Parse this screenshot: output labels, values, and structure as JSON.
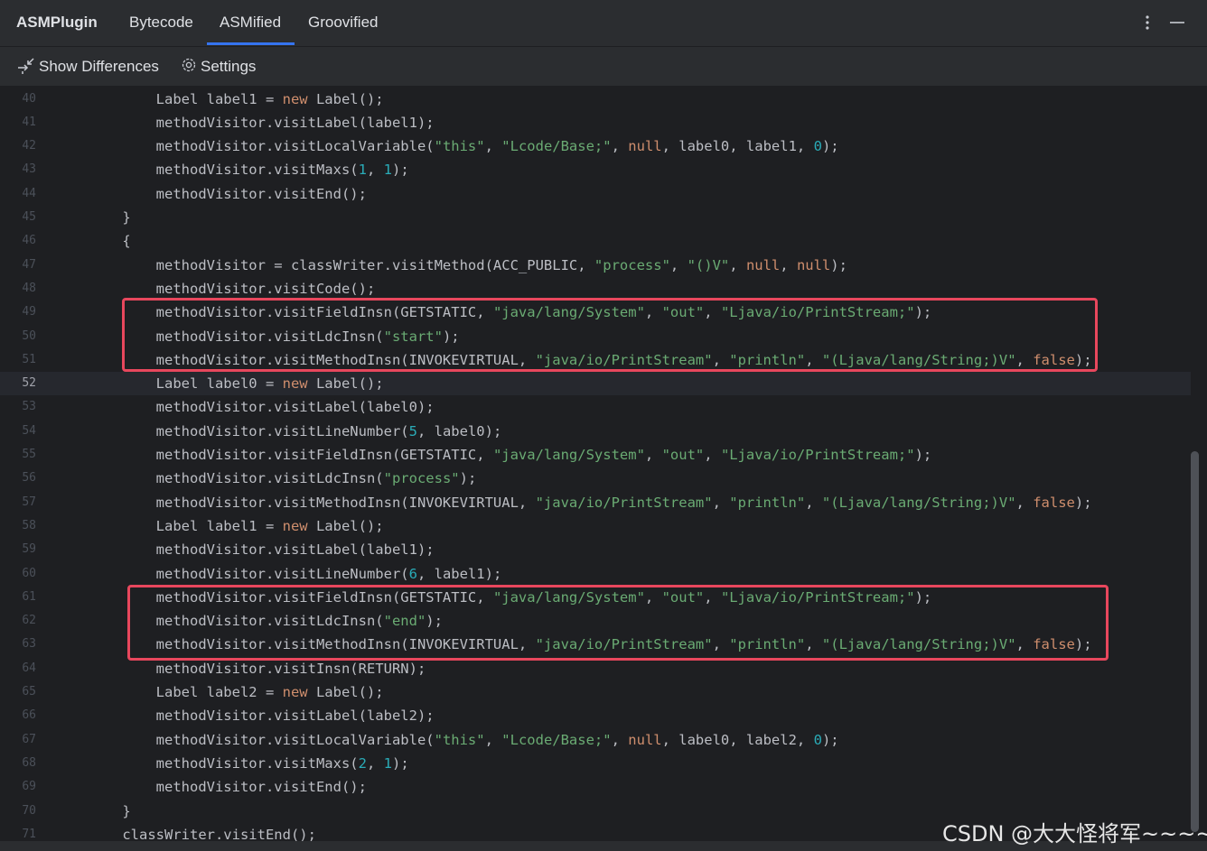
{
  "header": {
    "app_name": "ASMPlugin",
    "tabs": [
      {
        "label": "Bytecode",
        "active": false
      },
      {
        "label": "ASMified",
        "active": true
      },
      {
        "label": "Groovified",
        "active": false
      }
    ]
  },
  "toolbar": {
    "show_differences_label": "Show Differences",
    "settings_label": "Settings"
  },
  "editor": {
    "current_line": 52,
    "lines": [
      {
        "n": "40",
        "code": "        Label label1 = new Label();"
      },
      {
        "n": "41",
        "code": "        methodVisitor.visitLabel(label1);"
      },
      {
        "n": "42",
        "code": "        methodVisitor.visitLocalVariable(\"this\", \"Lcode/Base;\", null, label0, label1, 0);"
      },
      {
        "n": "43",
        "code": "        methodVisitor.visitMaxs(1, 1);"
      },
      {
        "n": "44",
        "code": "        methodVisitor.visitEnd();"
      },
      {
        "n": "45",
        "code": "    }"
      },
      {
        "n": "46",
        "code": "    {"
      },
      {
        "n": "47",
        "code": "        methodVisitor = classWriter.visitMethod(ACC_PUBLIC, \"process\", \"()V\", null, null);"
      },
      {
        "n": "48",
        "code": "        methodVisitor.visitCode();"
      },
      {
        "n": "49",
        "code": "        methodVisitor.visitFieldInsn(GETSTATIC, \"java/lang/System\", \"out\", \"Ljava/io/PrintStream;\");"
      },
      {
        "n": "50",
        "code": "        methodVisitor.visitLdcInsn(\"start\");"
      },
      {
        "n": "51",
        "code": "        methodVisitor.visitMethodInsn(INVOKEVIRTUAL, \"java/io/PrintStream\", \"println\", \"(Ljava/lang/String;)V\", false);"
      },
      {
        "n": "52",
        "code": "        Label label0 = new Label();"
      },
      {
        "n": "53",
        "code": "        methodVisitor.visitLabel(label0);"
      },
      {
        "n": "54",
        "code": "        methodVisitor.visitLineNumber(5, label0);"
      },
      {
        "n": "55",
        "code": "        methodVisitor.visitFieldInsn(GETSTATIC, \"java/lang/System\", \"out\", \"Ljava/io/PrintStream;\");"
      },
      {
        "n": "56",
        "code": "        methodVisitor.visitLdcInsn(\"process\");"
      },
      {
        "n": "57",
        "code": "        methodVisitor.visitMethodInsn(INVOKEVIRTUAL, \"java/io/PrintStream\", \"println\", \"(Ljava/lang/String;)V\", false);"
      },
      {
        "n": "58",
        "code": "        Label label1 = new Label();"
      },
      {
        "n": "59",
        "code": "        methodVisitor.visitLabel(label1);"
      },
      {
        "n": "60",
        "code": "        methodVisitor.visitLineNumber(6, label1);"
      },
      {
        "n": "61",
        "code": "        methodVisitor.visitFieldInsn(GETSTATIC, \"java/lang/System\", \"out\", \"Ljava/io/PrintStream;\");"
      },
      {
        "n": "62",
        "code": "        methodVisitor.visitLdcInsn(\"end\");"
      },
      {
        "n": "63",
        "code": "        methodVisitor.visitMethodInsn(INVOKEVIRTUAL, \"java/io/PrintStream\", \"println\", \"(Ljava/lang/String;)V\", false);"
      },
      {
        "n": "64",
        "code": "        methodVisitor.visitInsn(RETURN);"
      },
      {
        "n": "65",
        "code": "        Label label2 = new Label();"
      },
      {
        "n": "66",
        "code": "        methodVisitor.visitLabel(label2);"
      },
      {
        "n": "67",
        "code": "        methodVisitor.visitLocalVariable(\"this\", \"Lcode/Base;\", null, label0, label2, 0);"
      },
      {
        "n": "68",
        "code": "        methodVisitor.visitMaxs(2, 1);"
      },
      {
        "n": "69",
        "code": "        methodVisitor.visitEnd();"
      },
      {
        "n": "70",
        "code": "    }"
      },
      {
        "n": "71",
        "code": "    classWriter.visitEnd();"
      }
    ]
  },
  "colors": {
    "keyword": "#cf8e6d",
    "string": "#6aab73",
    "number": "#2aacb8",
    "highlight_box": "#e8475d",
    "active_tab_underline": "#3574f0"
  },
  "icons": [
    "show-differences-icon",
    "settings-gear-icon",
    "more-options-icon",
    "minimize-icon"
  ],
  "watermark": "CSDN @大大怪将军~~~~"
}
